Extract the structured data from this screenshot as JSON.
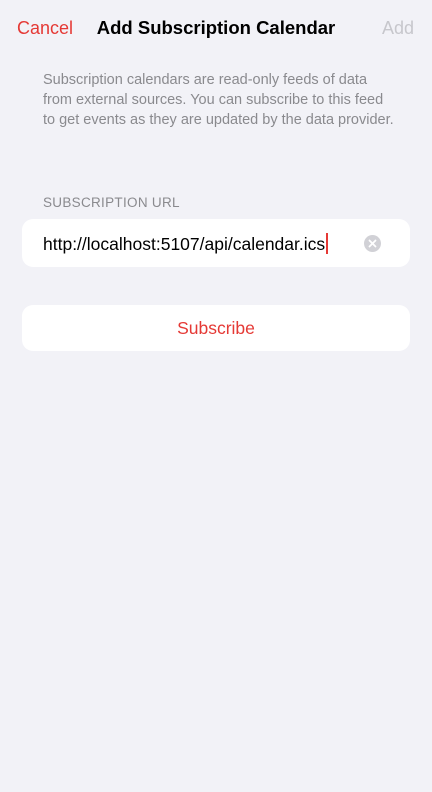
{
  "nav": {
    "cancel_label": "Cancel",
    "title": "Add Subscription Calendar",
    "add_label": "Add"
  },
  "description": "Subscription calendars are read-only feeds of data from external sources. You can subscribe to this feed to get events as they are updated by the data provider.",
  "url_section": {
    "label": "SUBSCRIPTION URL",
    "value": "http://localhost:5107/api/calendar.ics",
    "clear_icon": "clear-x-circle-icon"
  },
  "subscribe_label": "Subscribe",
  "colors": {
    "accent": "#e53935",
    "disabled": "#c7c7cc",
    "background": "#f2f2f7",
    "secondary_text": "#8a8a8e"
  }
}
